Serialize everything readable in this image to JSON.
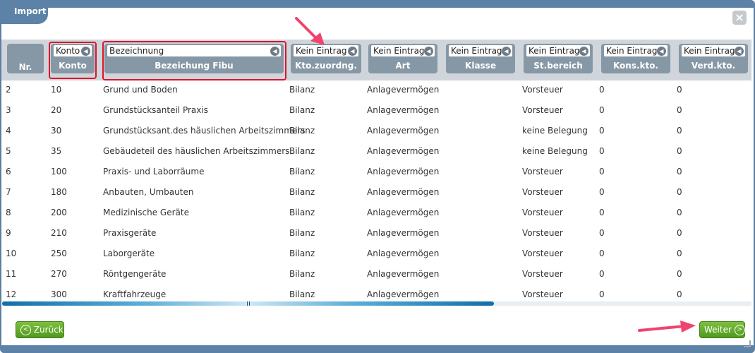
{
  "window": {
    "title": "Import"
  },
  "icons": {
    "close": "close-icon",
    "arrow": "chevron-left-icon",
    "annotation": "pink-pointer-arrow"
  },
  "colors": {
    "titlebar": "#5d82a8",
    "header": "#8697a5",
    "highlight": "#e0122a",
    "button": "#5aa624",
    "annotation": "#f0436e"
  },
  "columns": [
    {
      "label": "Nr."
    },
    {
      "select": "Konto",
      "label": "Konto"
    },
    {
      "select": "Bezeichnung",
      "label": "Bezeichung Fibu"
    },
    {
      "select": "Kein Eintrag",
      "label": "Kto.zuordng."
    },
    {
      "select": "Kein Eintrag",
      "label": "Art"
    },
    {
      "select": "Kein Eintrag",
      "label": "Klasse"
    },
    {
      "select": "Kein Eintrag",
      "label": "St.bereich"
    },
    {
      "select": "Kein Eintrag",
      "label": "Kons.kto."
    },
    {
      "select": "Kein Eintrag",
      "label": "Verd.kto."
    }
  ],
  "rows": [
    {
      "nr": "2",
      "konto": "10",
      "bez": "Grund und Boden",
      "kto": "Bilanz",
      "art": "Anlagevermögen",
      "klasse": "",
      "st": "Vorsteuer",
      "kons": "0",
      "verd": "0"
    },
    {
      "nr": "3",
      "konto": "20",
      "bez": "Grundstücksanteil Praxis",
      "kto": "Bilanz",
      "art": "Anlagevermögen",
      "klasse": "",
      "st": "Vorsteuer",
      "kons": "0",
      "verd": "0"
    },
    {
      "nr": "4",
      "konto": "30",
      "bez": "Grundstücksant.des häuslichen Arbeitszimmers",
      "kto": "Bilanz",
      "art": "Anlagevermögen",
      "klasse": "",
      "st": "keine Belegung",
      "kons": "0",
      "verd": "0"
    },
    {
      "nr": "5",
      "konto": "35",
      "bez": "Gebäudeteil des häuslichen Arbeitszimmers",
      "kto": "Bilanz",
      "art": "Anlagevermögen",
      "klasse": "",
      "st": "keine Belegung",
      "kons": "0",
      "verd": "0"
    },
    {
      "nr": "6",
      "konto": "100",
      "bez": "Praxis- und Laborräume",
      "kto": "Bilanz",
      "art": "Anlagevermögen",
      "klasse": "",
      "st": "Vorsteuer",
      "kons": "0",
      "verd": "0"
    },
    {
      "nr": "7",
      "konto": "180",
      "bez": "Anbauten, Umbauten",
      "kto": "Bilanz",
      "art": "Anlagevermögen",
      "klasse": "",
      "st": "Vorsteuer",
      "kons": "0",
      "verd": "0"
    },
    {
      "nr": "8",
      "konto": "200",
      "bez": "Medizinische Geräte",
      "kto": "Bilanz",
      "art": "Anlagevermögen",
      "klasse": "",
      "st": "Vorsteuer",
      "kons": "0",
      "verd": "0"
    },
    {
      "nr": "9",
      "konto": "210",
      "bez": "Praxisgeräte",
      "kto": "Bilanz",
      "art": "Anlagevermögen",
      "klasse": "",
      "st": "Vorsteuer",
      "kons": "0",
      "verd": "0"
    },
    {
      "nr": "10",
      "konto": "250",
      "bez": "Laborgeräte",
      "kto": "Bilanz",
      "art": "Anlagevermögen",
      "klasse": "",
      "st": "Vorsteuer",
      "kons": "0",
      "verd": "0"
    },
    {
      "nr": "11",
      "konto": "270",
      "bez": "Röntgengeräte",
      "kto": "Bilanz",
      "art": "Anlagevermögen",
      "klasse": "",
      "st": "Vorsteuer",
      "kons": "0",
      "verd": "0"
    },
    {
      "nr": "12",
      "konto": "300",
      "bez": "Kraftfahrzeuge",
      "kto": "Bilanz",
      "art": "Anlagevermögen",
      "klasse": "",
      "st": "Vorsteuer",
      "kons": "0",
      "verd": "0"
    }
  ],
  "footer": {
    "back_label": "Zurück",
    "next_label": "Weiter"
  }
}
